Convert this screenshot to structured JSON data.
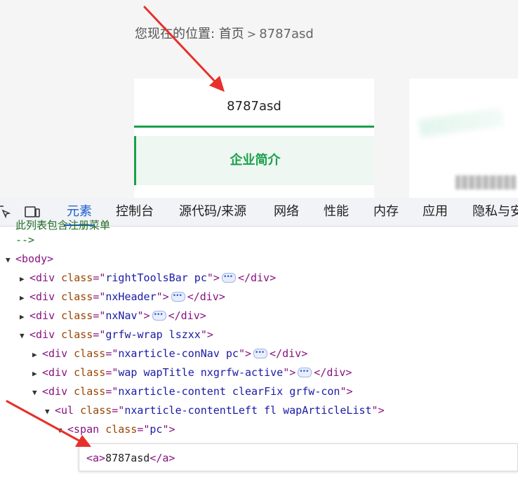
{
  "page": {
    "breadcrumb": {
      "prefix": "您现在的位置: 首页",
      "separator": ">",
      "current": "8787asd"
    },
    "nav": {
      "title": "8787asd",
      "active_item": "企业简介"
    }
  },
  "devtools": {
    "tabs": [
      {
        "label": "元素",
        "active": true
      },
      {
        "label": "控制台"
      },
      {
        "label": "源代码/来源"
      },
      {
        "label": "网络"
      },
      {
        "label": "性能"
      },
      {
        "label": "内存"
      },
      {
        "label": "应用"
      },
      {
        "label": "隐私与安"
      }
    ],
    "comment_tail": "此列表包含注册菜单",
    "comment_close": "-->",
    "nodes": {
      "body": "body",
      "n1": {
        "tag": "div",
        "attr": "class",
        "value": "rightToolsBar pc"
      },
      "n2": {
        "tag": "div",
        "attr": "class",
        "value": "nxHeader"
      },
      "n3": {
        "tag": "div",
        "attr": "class",
        "value": "nxNav"
      },
      "n4": {
        "tag": "div",
        "attr": "class",
        "value": "grfw-wrap lszxx"
      },
      "n5": {
        "tag": "div",
        "attr": "class",
        "value": "nxarticle-conNav pc"
      },
      "n6": {
        "tag": "div",
        "attr": "class",
        "value": "wap wapTitle nxgrfw-active"
      },
      "n7": {
        "tag": "div",
        "attr": "class",
        "value": "nxarticle-content clearFix grfw-con"
      },
      "n8": {
        "tag": "ul",
        "attr": "class",
        "value": "nxarticle-contentLeft fl wapArticleList"
      },
      "n9": {
        "tag": "span",
        "attr": "class",
        "value": "pc"
      }
    },
    "popup": {
      "open_tag": "<a>",
      "text": "8787asd",
      "close_tag": "</a>"
    }
  },
  "colors": {
    "accent_green": "#19a04a",
    "devtools_blue": "#1a5fd1",
    "arrow_red": "#e8302a"
  }
}
